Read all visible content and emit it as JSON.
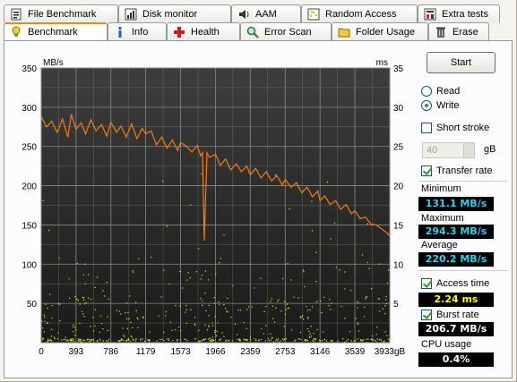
{
  "tabs_top": [
    {
      "label": "File Benchmark",
      "icon": "file-benchmark-icon"
    },
    {
      "label": "Disk monitor",
      "icon": "disk-monitor-icon"
    },
    {
      "label": "AAM",
      "icon": "speaker-icon"
    },
    {
      "label": "Random Access",
      "icon": "random-access-icon"
    },
    {
      "label": "Extra tests",
      "icon": "extra-tests-icon"
    }
  ],
  "tabs_bottom": [
    {
      "label": "Benchmark",
      "icon": "lightbulb-icon",
      "active": true
    },
    {
      "label": "Info",
      "icon": "info-icon"
    },
    {
      "label": "Health",
      "icon": "health-cross-icon"
    },
    {
      "label": "Error Scan",
      "icon": "magnifier-icon"
    },
    {
      "label": "Folder Usage",
      "icon": "folder-icon"
    },
    {
      "label": "Erase",
      "icon": "trash-icon"
    }
  ],
  "controls": {
    "start_label": "Start",
    "read_label": "Read",
    "write_label": "Write",
    "mode_selected": "Write",
    "short_stroke_label": "Short stroke",
    "short_stroke_checked": false,
    "stroke_value": "40",
    "stroke_unit": "gB",
    "transfer_rate_label": "Transfer rate",
    "transfer_rate_checked": true,
    "access_time_label": "Access time",
    "access_time_checked": true,
    "burst_rate_label": "Burst rate",
    "burst_rate_checked": true
  },
  "results": {
    "minimum_label": "Minimum",
    "minimum_value": "131.1 MB/s",
    "maximum_label": "Maximum",
    "maximum_value": "294.3 MB/s",
    "average_label": "Average",
    "average_value": "220.2 MB/s",
    "access_time_value": "2.24 ms",
    "burst_rate_value": "206.7 MB/s",
    "cpu_usage_label": "CPU usage",
    "cpu_usage_value": "0.4%"
  },
  "colors": {
    "plot_bg_top": "#3d3d3d",
    "plot_bg_bottom": "#1a1a18",
    "grid": "#8a8a8a",
    "transfer_line": "#f07d1c",
    "access_points": "#e8e81a",
    "value_cyan": "#2ed0f4",
    "value_yellow": "#ffff00"
  },
  "chart_data": {
    "type": "line",
    "y_left_label": "MB/s",
    "y_right_label": "ms",
    "x_unit": "gB",
    "x_ticks": [
      0,
      393,
      786,
      1179,
      1573,
      1966,
      2359,
      2753,
      3146,
      3539,
      3933
    ],
    "y_left_ticks": [
      50,
      100,
      150,
      200,
      250,
      300,
      350
    ],
    "y_right_ticks": [
      5,
      10,
      15,
      20,
      25,
      30,
      35
    ],
    "xlim": [
      0,
      3933
    ],
    "ylim_left": [
      0,
      350
    ],
    "ylim_right": [
      0,
      35
    ],
    "series": [
      {
        "name": "Transfer rate",
        "unit": "MB/s",
        "x": [
          0,
          60,
          120,
          180,
          240,
          300,
          340,
          393,
          450,
          500,
          560,
          620,
          680,
          740,
          786,
          850,
          900,
          960,
          1020,
          1080,
          1140,
          1179,
          1240,
          1300,
          1360,
          1420,
          1480,
          1540,
          1573,
          1640,
          1700,
          1760,
          1800,
          1820,
          1840,
          1870,
          1900,
          1966,
          2020,
          2080,
          2140,
          2200,
          2260,
          2320,
          2359,
          2420,
          2480,
          2540,
          2600,
          2660,
          2720,
          2753,
          2820,
          2880,
          2940,
          3000,
          3060,
          3120,
          3146,
          3200,
          3260,
          3320,
          3380,
          3440,
          3500,
          3539,
          3600,
          3660,
          3720,
          3780,
          3840,
          3900,
          3933
        ],
        "values": [
          288,
          275,
          282,
          268,
          285,
          262,
          291,
          272,
          280,
          266,
          284,
          270,
          278,
          263,
          281,
          268,
          276,
          262,
          279,
          260,
          273,
          266,
          270,
          252,
          262,
          248,
          258,
          245,
          255,
          250,
          243,
          251,
          238,
          242,
          130,
          242,
          236,
          240,
          226,
          234,
          220,
          228,
          218,
          225,
          214,
          222,
          210,
          218,
          206,
          213,
          201,
          208,
          198,
          204,
          191,
          198,
          186,
          193,
          181,
          187,
          176,
          181,
          170,
          176,
          164,
          168,
          158,
          160,
          151,
          150,
          145,
          140,
          136
        ]
      },
      {
        "name": "Access time",
        "unit": "ms",
        "type": "scatter",
        "note": "spread 0-23 ms, most below 6 ms"
      }
    ]
  }
}
